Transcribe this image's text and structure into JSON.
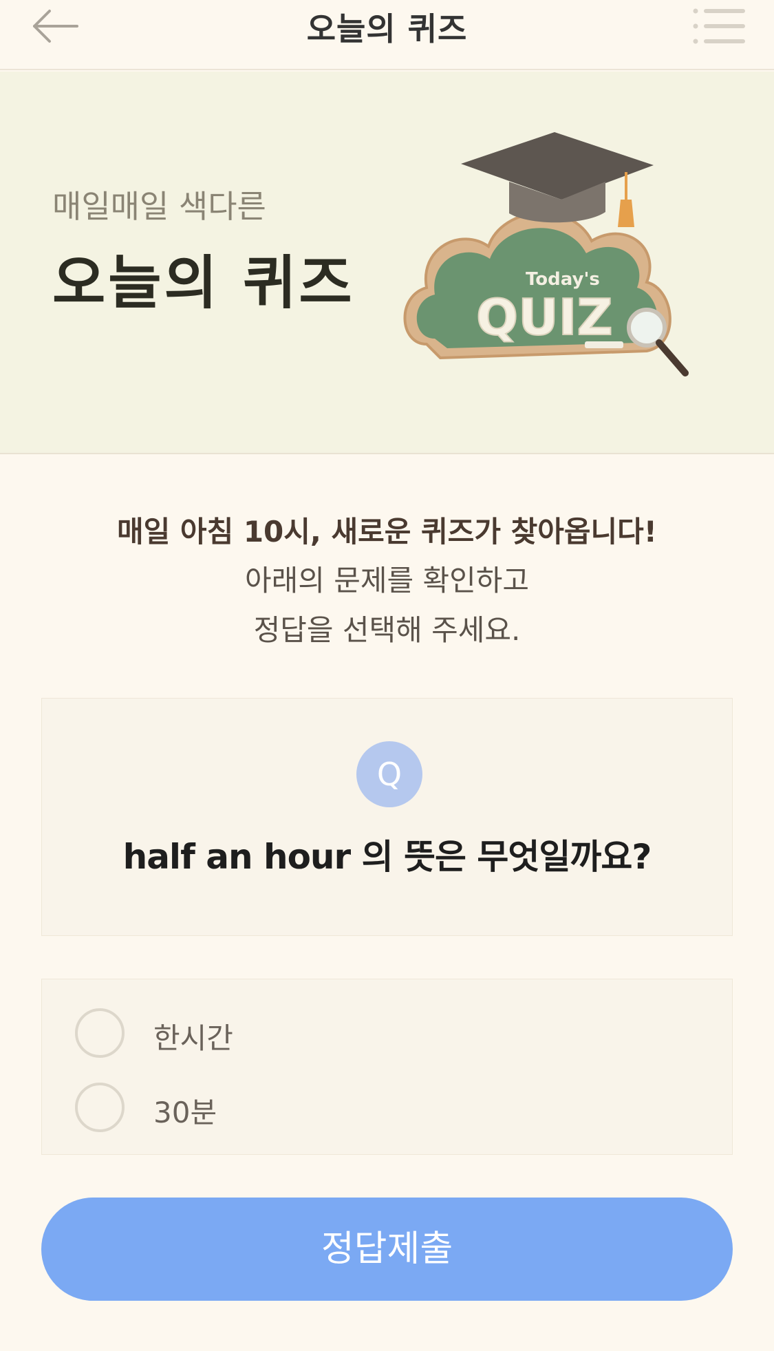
{
  "header": {
    "title": "오늘의 퀴즈"
  },
  "banner": {
    "subtitle": "매일매일 색다른",
    "title": "오늘의 퀴즈",
    "art_small_text": "Today's",
    "art_big_text": "QUIZ"
  },
  "intro": {
    "bold_line": "매일 아침 10시, 새로운 퀴즈가 찾아옵니다!",
    "line2": "아래의 문제를 확인하고",
    "line3": "정답을 선택해 주세요."
  },
  "question": {
    "badge": "Q",
    "text": "half an hour 의 뜻은 무엇일까요?"
  },
  "options": [
    {
      "label": "한시간",
      "selected": false
    },
    {
      "label": "30분",
      "selected": false
    }
  ],
  "submit_label": "정답제출",
  "colors": {
    "background": "#fdf8ef",
    "banner_bg": "#f4f3e2",
    "accent_blue": "#7ba9f3",
    "badge_blue": "#b5c8ee",
    "chalkboard_green": "#6b9470"
  },
  "icons": {
    "back": "back-arrow-icon",
    "menu": "list-menu-icon"
  }
}
